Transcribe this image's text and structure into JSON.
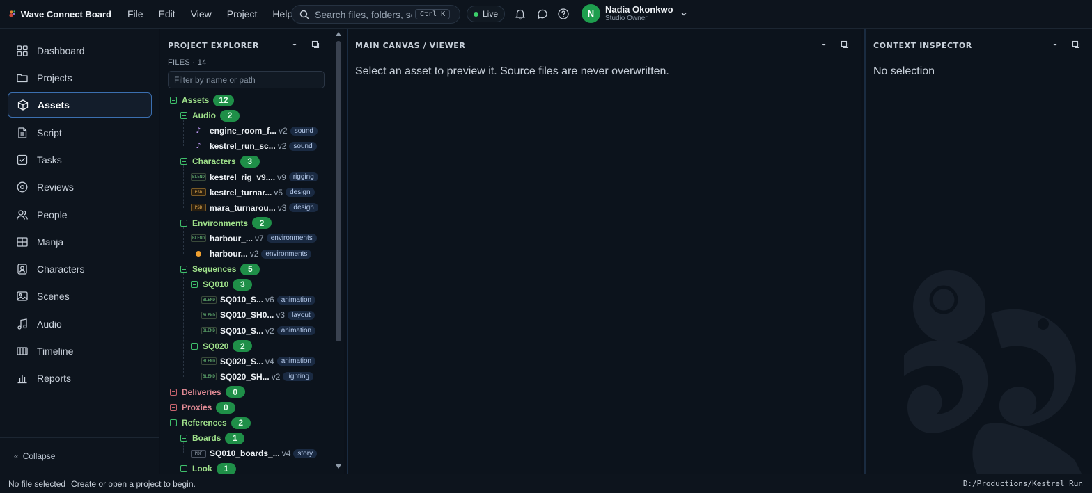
{
  "app": {
    "name": "Wave Connect Board",
    "menu": [
      "File",
      "Edit",
      "View",
      "Project",
      "Help"
    ]
  },
  "search": {
    "placeholder": "Search files, folders, scer",
    "shortcut": "Ctrl K"
  },
  "live": {
    "label": "Live"
  },
  "user": {
    "initial": "N",
    "name": "Nadia Okonkwo",
    "role": "Studio Owner"
  },
  "sidebar": {
    "items": [
      {
        "label": "Dashboard",
        "icon": "dashboard-icon"
      },
      {
        "label": "Projects",
        "icon": "folder-icon"
      },
      {
        "label": "Assets",
        "icon": "cube-icon",
        "active": true
      },
      {
        "label": "Script",
        "icon": "document-icon"
      },
      {
        "label": "Tasks",
        "icon": "checkbox-icon"
      },
      {
        "label": "Reviews",
        "icon": "target-icon"
      },
      {
        "label": "People",
        "icon": "people-icon"
      },
      {
        "label": "Manja",
        "icon": "grid-icon"
      },
      {
        "label": "Characters",
        "icon": "portrait-icon"
      },
      {
        "label": "Scenes",
        "icon": "image-icon"
      },
      {
        "label": "Audio",
        "icon": "music-icon"
      },
      {
        "label": "Timeline",
        "icon": "timeline-icon"
      },
      {
        "label": "Reports",
        "icon": "bar-chart-icon"
      }
    ],
    "collapse_label": "Collapse",
    "collapse_glyph": "«"
  },
  "explorer": {
    "title": "PROJECT EXPLORER",
    "files_count": "FILES · 14",
    "filter_placeholder": "Filter by name or path",
    "rows": [
      {
        "type": "folder",
        "depth": 0,
        "name": "Assets",
        "count": "12"
      },
      {
        "type": "folder",
        "depth": 1,
        "name": "Audio",
        "count": "2"
      },
      {
        "type": "file",
        "depth": 2,
        "icon": "note",
        "icon_text": "♪",
        "name": "engine_room_f...",
        "version": "v2",
        "tag": "sound"
      },
      {
        "type": "file",
        "depth": 2,
        "icon": "note",
        "icon_text": "♪",
        "name": "kestrel_run_sc...",
        "version": "v2",
        "tag": "sound"
      },
      {
        "type": "folder",
        "depth": 1,
        "name": "Characters",
        "count": "3"
      },
      {
        "type": "file",
        "depth": 2,
        "icon": "blend",
        "icon_text": "BLEND",
        "name": "kestrel_rig_v9....",
        "version": "v9",
        "tag": "rigging"
      },
      {
        "type": "file",
        "depth": 2,
        "icon": "psd",
        "icon_text": "PSD",
        "name": "kestrel_turnar...",
        "version": "v5",
        "tag": "design"
      },
      {
        "type": "file",
        "depth": 2,
        "icon": "psd",
        "icon_text": "PSD",
        "name": "mara_turnarou...",
        "version": "v3",
        "tag": "design"
      },
      {
        "type": "folder",
        "depth": 1,
        "name": "Environments",
        "count": "2"
      },
      {
        "type": "file",
        "depth": 2,
        "icon": "blend",
        "icon_text": "BLEND",
        "name": "harbour_...",
        "version": "v7",
        "tag": "environments"
      },
      {
        "type": "file",
        "depth": 2,
        "icon": "dot",
        "icon_text": "",
        "name": "harbour...",
        "version": "v2",
        "tag": "environments"
      },
      {
        "type": "folder",
        "depth": 1,
        "name": "Sequences",
        "count": "5"
      },
      {
        "type": "folder",
        "depth": 2,
        "name": "SQ010",
        "count": "3"
      },
      {
        "type": "file",
        "depth": 3,
        "icon": "blend",
        "icon_text": "BLEND",
        "name": "SQ010_S...",
        "version": "v6",
        "tag": "animation"
      },
      {
        "type": "file",
        "depth": 3,
        "icon": "blend",
        "icon_text": "BLEND",
        "name": "SQ010_SH0...",
        "version": "v3",
        "tag": "layout"
      },
      {
        "type": "file",
        "depth": 3,
        "icon": "blend",
        "icon_text": "BLEND",
        "name": "SQ010_S...",
        "version": "v2",
        "tag": "animation"
      },
      {
        "type": "folder",
        "depth": 2,
        "name": "SQ020",
        "count": "2"
      },
      {
        "type": "file",
        "depth": 3,
        "icon": "blend",
        "icon_text": "BLEND",
        "name": "SQ020_S...",
        "version": "v4",
        "tag": "animation"
      },
      {
        "type": "file",
        "depth": 3,
        "icon": "blend",
        "icon_text": "BLEND",
        "name": "SQ020_SH...",
        "version": "v2",
        "tag": "lighting"
      },
      {
        "type": "folder",
        "depth": 0,
        "name": "Deliveries",
        "count": "0",
        "empty": true
      },
      {
        "type": "folder",
        "depth": 0,
        "name": "Proxies",
        "count": "0",
        "empty": true
      },
      {
        "type": "folder",
        "depth": 0,
        "name": "References",
        "count": "2"
      },
      {
        "type": "folder",
        "depth": 1,
        "name": "Boards",
        "count": "1"
      },
      {
        "type": "file",
        "depth": 2,
        "icon": "pdf",
        "icon_text": "PDF",
        "name": "SQ010_boards_...",
        "version": "v4",
        "tag": "story"
      },
      {
        "type": "folder",
        "depth": 1,
        "name": "Look",
        "count": "1"
      }
    ]
  },
  "canvas": {
    "title": "MAIN CANVAS / VIEWER",
    "message": "Select an asset to preview it. Source files are never overwritten."
  },
  "inspector": {
    "title": "CONTEXT INSPECTOR",
    "message": "No selection"
  },
  "status": {
    "file": "No file selected",
    "hint": "Create or open a project to begin.",
    "path": "D:/Productions/Kestrel Run"
  },
  "colors": {
    "accent": "#3b6fb0",
    "badge_green": "#1f8f48",
    "folder_green": "#9fe08a",
    "folder_red": "#e08a94",
    "live_green": "#3ccf6a"
  }
}
